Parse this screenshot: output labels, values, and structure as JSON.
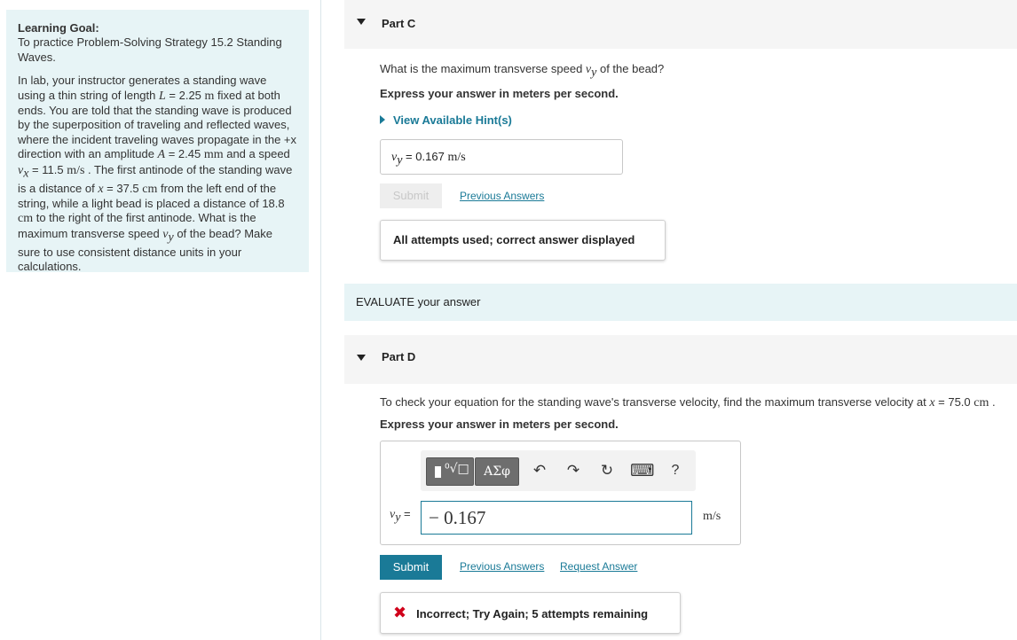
{
  "learning_goal": {
    "title": "Learning Goal:",
    "subtitle": "To practice Problem-Solving Strategy 15.2 Standing Waves.",
    "t1": "In lab, your instructor generates a standing wave using a thin string of length ",
    "L_sym": "L",
    "t2": " = 2.25 ",
    "m_unit": "m",
    "t3": " fixed at both ends. You are told that the standing wave is produced by the superposition of traveling and reflected waves, where the incident traveling waves propagate in the +x direction with an amplitude ",
    "A_sym": "A",
    "t4": " = 2.45 ",
    "mm_unit": "mm",
    "t5": " and a speed ",
    "vx_base": "v",
    "vx_sub": "x",
    "t6": " = 11.5 ",
    "ms_unit": "m/s",
    "t7": " . The first antinode of the standing wave is a distance of ",
    "x_sym": "x",
    "t8": " = 37.5 ",
    "cm_unit": "cm",
    "t9": " from the left end of the string, while a light bead is placed a distance of 18.8 ",
    "cm_unit2": "cm",
    "t10": " to the right of the first antinode. What is the maximum transverse speed ",
    "vy_base": "v",
    "vy_sub": "y",
    "t11": " of the bead? Make sure to use consistent distance units in your calculations."
  },
  "part_c": {
    "title": "Part C",
    "q1": "What is the maximum transverse speed ",
    "q_var": "v",
    "q_sub": "y",
    "q2": " of the bead?",
    "instruction": "Express your answer in meters per second.",
    "hint": "View Available Hint(s)",
    "answer_var": "v",
    "answer_sub": "y",
    "answer_eq": " = ",
    "answer_value": "0.167",
    "answer_unit": "m/s",
    "submit": "Submit",
    "previous": "Previous Answers",
    "feedback": "All attempts used; correct answer displayed"
  },
  "evaluate": {
    "label": "EVALUATE your answer"
  },
  "part_d": {
    "title": "Part D",
    "q1": "To check your equation for the standing wave's transverse velocity, find the maximum transverse velocity at ",
    "q_var": "x",
    "q2": " = 75.0 ",
    "q_unit": "cm",
    "q3": " .",
    "instruction": "Express your answer in meters per second.",
    "toolbar": {
      "greek": "ΑΣφ",
      "undo": "↶",
      "redo": "↷",
      "reset": "↻",
      "keyboard": "⌨",
      "help": "?"
    },
    "var": "v",
    "var_sub": "y",
    "eq": " =",
    "answer": "− 0.167",
    "unit": "m/s",
    "submit": "Submit",
    "previous": "Previous Answers",
    "request": "Request Answer",
    "feedback_icon": "✖",
    "feedback": "Incorrect; Try Again; 5 attempts remaining"
  },
  "colors": {
    "accent": "#1a7a97",
    "panel": "#e7f4f6",
    "error": "#d0021b"
  }
}
